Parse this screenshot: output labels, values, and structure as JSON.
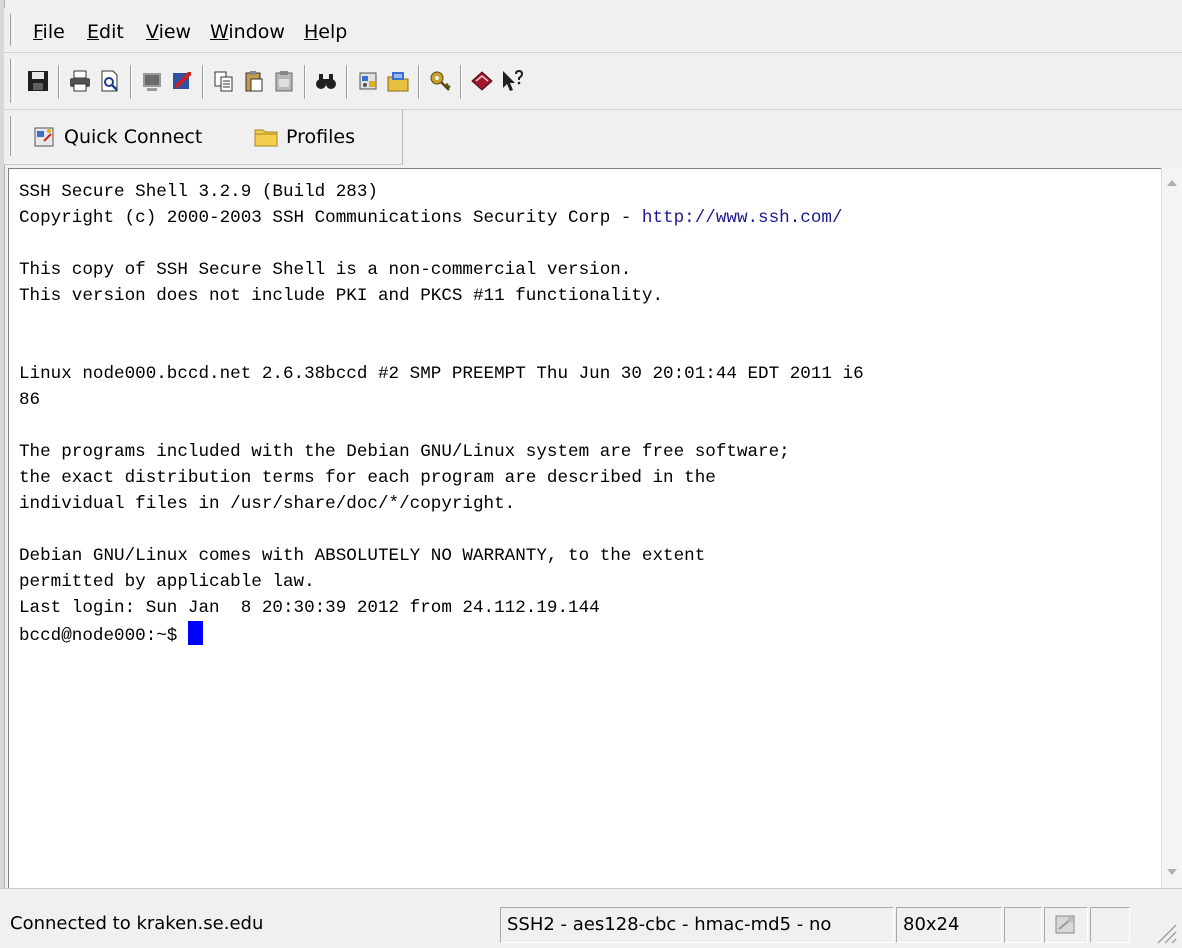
{
  "menu": {
    "items": [
      {
        "label": "File",
        "underline": "F",
        "rest": "ile"
      },
      {
        "label": "Edit",
        "underline": "E",
        "rest": "dit"
      },
      {
        "label": "View",
        "underline": "V",
        "rest": "iew"
      },
      {
        "label": "Window",
        "underline": "W",
        "rest": "indow"
      },
      {
        "label": "Help",
        "underline": "H",
        "rest": "elp"
      }
    ]
  },
  "toolbar": {
    "icons": [
      "save-icon",
      "print-icon",
      "print-preview-icon",
      "new-terminal-icon",
      "new-file-transfer-icon",
      "copy-icon",
      "paste-icon",
      "paste-disabled-icon",
      "find-icon",
      "settings-icon",
      "profile-settings-icon",
      "key-icon",
      "help-book-icon",
      "context-help-icon"
    ]
  },
  "connectbar": {
    "quick_connect": "Quick Connect",
    "profiles": "Profiles"
  },
  "terminal": {
    "lines": [
      "SSH Secure Shell 3.2.9 (Build 283)",
      "Copyright (c) 2000-2003 SSH Communications Security Corp - ",
      "http://www.ssh.com/",
      "",
      "This copy of SSH Secure Shell is a non-commercial version.",
      "This version does not include PKI and PKCS #11 functionality.",
      "",
      "",
      "Linux node000.bccd.net 2.6.38bccd #2 SMP PREEMPT Thu Jun 30 20:01:44 EDT 2011 i6",
      "86",
      "",
      "The programs included with the Debian GNU/Linux system are free software;",
      "the exact distribution terms for each program are described in the",
      "individual files in /usr/share/doc/*/copyright.",
      "",
      "Debian GNU/Linux comes with ABSOLUTELY NO WARRANTY, to the extent",
      "permitted by applicable law.",
      "Last login: Sun Jan  8 20:30:39 2012 from 24.112.19.144",
      "bccd@node000:~$ "
    ],
    "cursor_color": "#0000ff"
  },
  "status": {
    "connection": "Connected to kraken.se.edu",
    "cipher": "SSH2 - aes128-cbc - hmac-md5 - no",
    "size": "80x24"
  }
}
